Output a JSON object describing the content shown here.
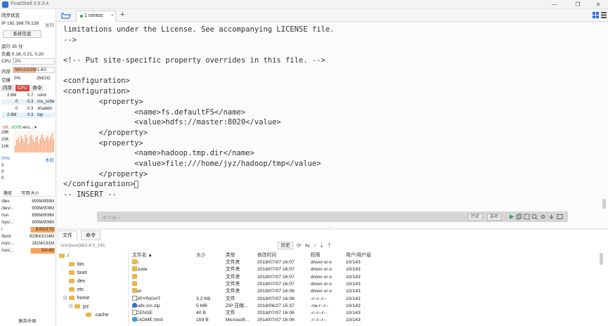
{
  "window": {
    "title": "FinalShell 3.9.3.4",
    "controls": [
      "—",
      "❐",
      "✕"
    ]
  },
  "left": {
    "status_title": "同步状态",
    "ip_text": "IP 192.168.78.128",
    "copy_label": "复制",
    "sysinfo_label": "系统信息",
    "uptime": "运行 35 分",
    "load": "负载 0.18, 0.21, 0.20",
    "cpu_label": "CPU",
    "cpu_value": "2%",
    "cpu_fraction": 0.02,
    "mem_label": "内存",
    "mem_value": "56%",
    "mem_detail": "1022M/1.8G",
    "mem_fraction": 0.56,
    "swap_label": "交换",
    "swap_value": "0%",
    "swap_detail": "2M/2G",
    "tabs": [
      "内存",
      "CPU",
      "命令"
    ],
    "processes": [
      {
        "mem": "2.8M",
        "cpu": "0.7",
        "cmd": "sshd"
      },
      {
        "mem": "0",
        "cpu": "0.3",
        "cmd": "rcu_sche"
      },
      {
        "mem": "0",
        "cpu": "0.3",
        "cmd": "xfsaild/c"
      },
      {
        "mem": "2.9M",
        "cpu": "0.3",
        "cmd": "top"
      }
    ],
    "net_up": "↑6K",
    "net_down": "↓600B",
    "net_iface": "ens...",
    "net_scale": [
      "29K",
      "20K",
      "10K"
    ],
    "latency_label": "0ms",
    "latency_host": "本机",
    "latency_values": [
      "0",
      "0",
      "0"
    ],
    "disk_header": {
      "path": "路径",
      "avail": "可用/大小"
    },
    "disks": [
      {
        "path": "/dev",
        "value": "893M/893M"
      },
      {
        "path": "/dev/...",
        "value": "909M/909M"
      },
      {
        "path": "/run",
        "value": "899M/909M"
      },
      {
        "path": "/sys/...",
        "value": "909M/909M"
      },
      {
        "path": "/",
        "value": "8.6G/17G"
      },
      {
        "path": "/boot",
        "value": "829M/1014M"
      },
      {
        "path": "/run/...",
        "value": "181M/181M"
      },
      {
        "path": "/run/...",
        "value": "0/4.4G"
      }
    ],
    "activate_label": "激活/升级"
  },
  "tabs": {
    "active_label": "1 centos",
    "close": "×",
    "add": "+"
  },
  "terminal": {
    "lines": [
      "limitations under the License. See accompanying LICENSE file.",
      "-->",
      "",
      "<!-- Put site-specific property overrides in this file. -->",
      "",
      "<configuration>",
      "<configuration>",
      "        <property>",
      "                <name>fs.defaultFS</name>",
      "                <value>hdfs://master:8020</value>",
      "        </property>",
      "        <property>",
      "                <name>hadoop.tmp.dir</name>",
      "                <value>file:///home/jyz/hadoop/tmp</value>",
      "        </property>",
      "</configuration>",
      "-- INSERT --"
    ],
    "command_placeholder": "命令输入",
    "history_label": "历史",
    "options_label": "选项"
  },
  "files": {
    "tabs": [
      "文件",
      "命令"
    ],
    "path": "/usr/java/jdk1.8.0_181",
    "history_label": "历史",
    "tree": [
      {
        "label": "/",
        "expand": ""
      },
      {
        "label": "bin",
        "expand": ""
      },
      {
        "label": "boot",
        "expand": ""
      },
      {
        "label": "dev",
        "expand": ""
      },
      {
        "label": "etc",
        "expand": ""
      },
      {
        "label": "home",
        "expand": "⊟"
      },
      {
        "label": "jyz",
        "expand": "⊟"
      },
      {
        "label": ".cache",
        "expand": ""
      }
    ],
    "columns": [
      "文件名 ▲",
      "大小",
      "类型",
      "修改时间",
      "权限",
      "用户/用户组"
    ],
    "rows": [
      {
        "name": "bin",
        "size": "",
        "type": "文件夹",
        "time": "2018/07/07 16:07",
        "perm": "drwxr-xr-x",
        "owner": "10/143",
        "kind": "folder"
      },
      {
        "name": "include",
        "size": "",
        "type": "文件夹",
        "time": "2018/07/07 16:07",
        "perm": "drwxr-xr-x",
        "owner": "10/143",
        "kind": "folder"
      },
      {
        "name": "jre",
        "size": "",
        "type": "文件夹",
        "time": "2018/07/07 16:07",
        "perm": "drwxr-xr-x",
        "owner": "10/143",
        "kind": "folder"
      },
      {
        "name": "lib",
        "size": "",
        "type": "文件夹",
        "time": "2018/07/07 16:07",
        "perm": "drwxr-xr-x",
        "owner": "10/143",
        "kind": "folder"
      },
      {
        "name": "man",
        "size": "",
        "type": "文件夹",
        "time": "2018/07/07 16:06",
        "perm": "drwxr-xr-x",
        "owner": "10/143",
        "kind": "folder"
      },
      {
        "name": "COPYRIGHT",
        "size": "3.2 KB",
        "type": "文件",
        "time": "2018/07/07 16:06",
        "perm": "-r--r--r--",
        "owner": "10/143",
        "kind": "file"
      },
      {
        "name": "javafx-src.zip",
        "size": "5 MB",
        "type": "ZIP 压缩...",
        "time": "2018/06/27 15:37",
        "perm": "-rw-r--r--",
        "owner": "10/143",
        "kind": "zip"
      },
      {
        "name": "LICENSE",
        "size": "40 B",
        "type": "文件",
        "time": "2018/07/07 16:06",
        "perm": "-r--r--r--",
        "owner": "10/143",
        "kind": "file"
      },
      {
        "name": "README.html",
        "size": "159 B",
        "type": "Microsoft...",
        "time": "2018/07/07 16:06",
        "perm": "-r--r--r--",
        "owner": "10/143",
        "kind": "html"
      }
    ]
  },
  "colors": {
    "accent_blue": "#2e6fd6",
    "cpu_tab_red": "#d9443f",
    "mem_orange": "#f3b38a",
    "disk_orange": "#f5a35c",
    "net_bar": "#f4a77a",
    "active_green": "#2aa84a",
    "folder_yellow": "#e8b84a"
  }
}
